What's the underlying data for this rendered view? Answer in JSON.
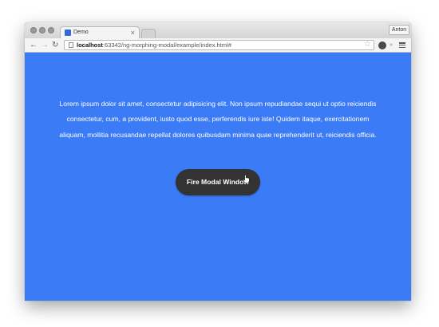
{
  "browser": {
    "tab_title": "Demo",
    "tab_close": "×",
    "profile_name": "Anton",
    "url_host": "localhost",
    "url_rest": ":63342/ng-morphing-modal/example/index.html#",
    "back_icon": "arrow-left-icon",
    "forward_icon": "arrow-right-icon",
    "reload_icon": "reload-icon",
    "bookmark_icon": "star-icon",
    "menu_icon": "hamburger-menu-icon"
  },
  "page": {
    "background_color": "#3b7bf5",
    "paragraph": "Lorem ipsum dolor sit amet, consectetur adipisicing elit. Non ipsum repudiandae sequi ut optio reiciendis consectetur, cum, a provident, iusto quod esse, perferendis iure iste! Quidem itaque, exercitationem aliquam, mollitia recusandae repellat dolores quibusdam minima quae reprehenderit ut, reiciendis officia.",
    "fire_button_label": "Fire Modal Window",
    "button_color": "#333333"
  }
}
